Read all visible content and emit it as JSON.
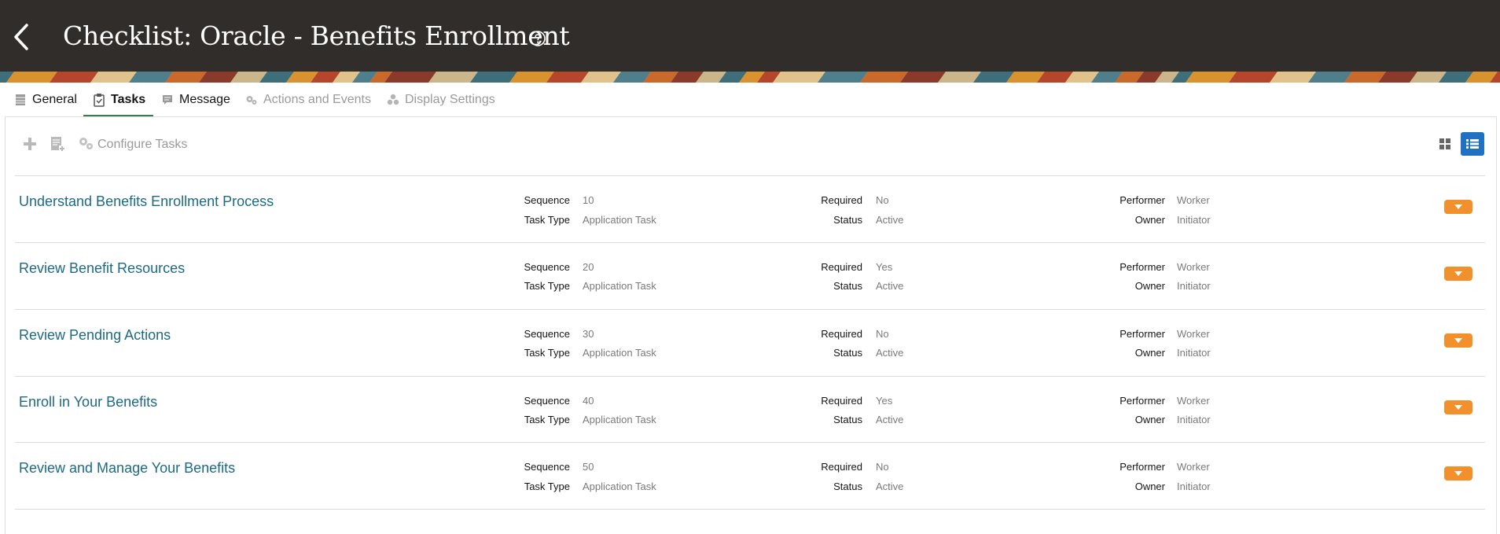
{
  "header": {
    "title": "Checklist: Oracle - Benefits Enrollment",
    "icons": {
      "back": "chevron-left-icon",
      "help": "help-circle-icon"
    }
  },
  "tabs": [
    {
      "label": "General",
      "icon": "table-icon",
      "state": "normal"
    },
    {
      "label": "Tasks",
      "icon": "clipboard-check-icon",
      "state": "active"
    },
    {
      "label": "Message",
      "icon": "message-icon",
      "state": "normal"
    },
    {
      "label": "Actions and Events",
      "icon": "gears-icon",
      "state": "disabled"
    },
    {
      "label": "Display Settings",
      "icon": "shapes-icon",
      "state": "disabled"
    }
  ],
  "toolbar": {
    "add_icon": "plus-icon",
    "add_from_icon": "add-document-icon",
    "configure_icon": "gears-icon",
    "configure_label": "Configure Tasks",
    "grid_view_icon": "grid-view-icon",
    "list_view_icon": "list-view-icon"
  },
  "field_labels": {
    "sequence": "Sequence",
    "task_type": "Task Type",
    "required": "Required",
    "status": "Status",
    "performer": "Performer",
    "owner": "Owner"
  },
  "tasks": [
    {
      "name": "Understand Benefits Enrollment Process",
      "sequence": "10",
      "task_type": "Application Task",
      "required": "No",
      "status": "Active",
      "performer": "Worker",
      "owner": "Initiator"
    },
    {
      "name": "Review Benefit Resources",
      "sequence": "20",
      "task_type": "Application Task",
      "required": "Yes",
      "status": "Active",
      "performer": "Worker",
      "owner": "Initiator"
    },
    {
      "name": "Review Pending Actions",
      "sequence": "30",
      "task_type": "Application Task",
      "required": "No",
      "status": "Active",
      "performer": "Worker",
      "owner": "Initiator"
    },
    {
      "name": "Enroll in Your Benefits",
      "sequence": "40",
      "task_type": "Application Task",
      "required": "Yes",
      "status": "Active",
      "performer": "Worker",
      "owner": "Initiator"
    },
    {
      "name": "Review and Manage Your Benefits",
      "sequence": "50",
      "task_type": "Application Task",
      "required": "No",
      "status": "Active",
      "performer": "Worker",
      "owner": "Initiator"
    }
  ],
  "colors": {
    "header_bg": "#312d2a",
    "link": "#1c6a86",
    "action_button": "#f2912b",
    "active_tab_underline": "#3f7a4f",
    "selected_view_button": "#2071c4"
  }
}
